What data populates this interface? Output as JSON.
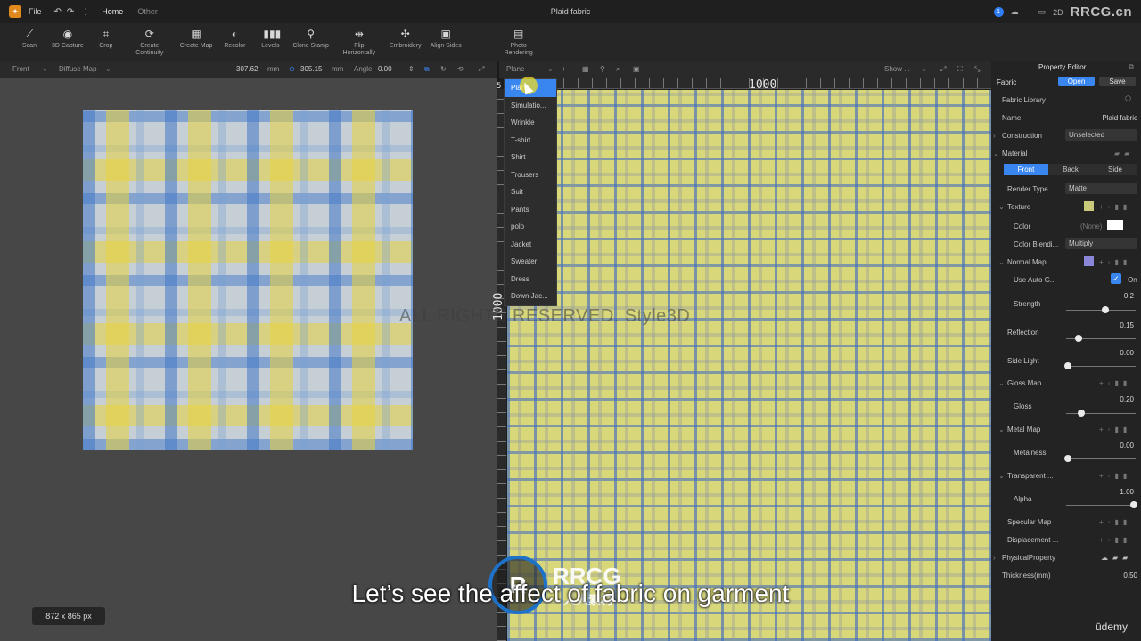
{
  "titlebar": {
    "file_menu": "File",
    "tab_home": "Home",
    "tab_other": "Other",
    "title": "Plaid fabric",
    "notif_count": "1",
    "view_mode": "2D",
    "watermark": "RRCG.cn"
  },
  "toolbar": {
    "tools": [
      {
        "label": "Scan"
      },
      {
        "label": "3D Capture"
      },
      {
        "label": "Crop"
      },
      {
        "label": "Create Continuity"
      },
      {
        "label": "Create Map"
      },
      {
        "label": "Recolor"
      },
      {
        "label": "Levels"
      },
      {
        "label": "Clone Stamp"
      },
      {
        "label": "Flip Horizontally"
      },
      {
        "label": "Embroidery"
      },
      {
        "label": "Align Sides"
      },
      {
        "label": "Photo Rendering"
      }
    ]
  },
  "subbar": {
    "view": "Front",
    "map": "Diffuse Map",
    "width": "307.62",
    "width_unit": "mm",
    "height": "305.15",
    "height_unit": "mm",
    "angle_label": "Angle",
    "angle": "0.00",
    "plane": "Plane",
    "show": "Show ..."
  },
  "left": {
    "size_badge": "872 x 865 px"
  },
  "canvas": {
    "ruler_top": "1000",
    "ruler_left": "1000",
    "ruler_corner": "5",
    "watermark": "ALL RIGHTS RESERVED.  Style3D"
  },
  "dropdown": {
    "items": [
      "Plane",
      "Simulatio...",
      "Wrinkle",
      "T-shirt",
      "Shirt",
      "Trousers",
      "Suit",
      "Pants",
      "polo",
      "Jacket",
      "Sweater",
      "Dress",
      "Down Jac..."
    ]
  },
  "property_editor": {
    "title": "Property Editor",
    "fabric_label": "Fabric",
    "open": "Open",
    "save": "Save",
    "library": "Fabric Library",
    "name_label": "Name",
    "name_value": "Plaid fabric",
    "construction_label": "Construction",
    "construction_value": "Unselected",
    "material_label": "Material",
    "seg_front": "Front",
    "seg_back": "Back",
    "seg_side": "Side",
    "render_type_label": "Render Type",
    "render_type_value": "Matte",
    "texture_label": "Texture",
    "color_label": "Color",
    "color_value": "(None)",
    "color_blend_label": "Color Blendi...",
    "color_blend_value": "Multiply",
    "normal_map_label": "Normal Map",
    "use_auto_label": "Use Auto G...",
    "use_auto_value": "On",
    "strength_label": "Strength",
    "strength_value": "0.2",
    "reflection_label": "Reflection",
    "reflection_value": "0.15",
    "side_light_label": "Side Light",
    "side_light_value": "0.00",
    "gloss_map_label": "Gloss Map",
    "gloss_label": "Gloss",
    "gloss_value": "0.20",
    "metal_map_label": "Metal Map",
    "metalness_label": "Metalness",
    "metalness_value": "0.00",
    "transparent_label": "Transparent ...",
    "alpha_label": "Alpha",
    "alpha_value": "1.00",
    "specular_label": "Specular Map",
    "displacement_label": "Displacement ...",
    "physical_label": "PhysicalProperty",
    "thickness_label": "Thickness(mm)",
    "thickness_value": "0.50",
    "colors": {
      "accent": "#3a86f0",
      "texture_swatch": "#c9c97a",
      "normal_swatch": "#8a86d8"
    }
  },
  "subtitle": {
    "text": "Let’s see the affect of fabric on garment",
    "platform": "ūdemy"
  },
  "overlay": {
    "logo_text": "RRCG",
    "logo_sub": "人人素材"
  }
}
